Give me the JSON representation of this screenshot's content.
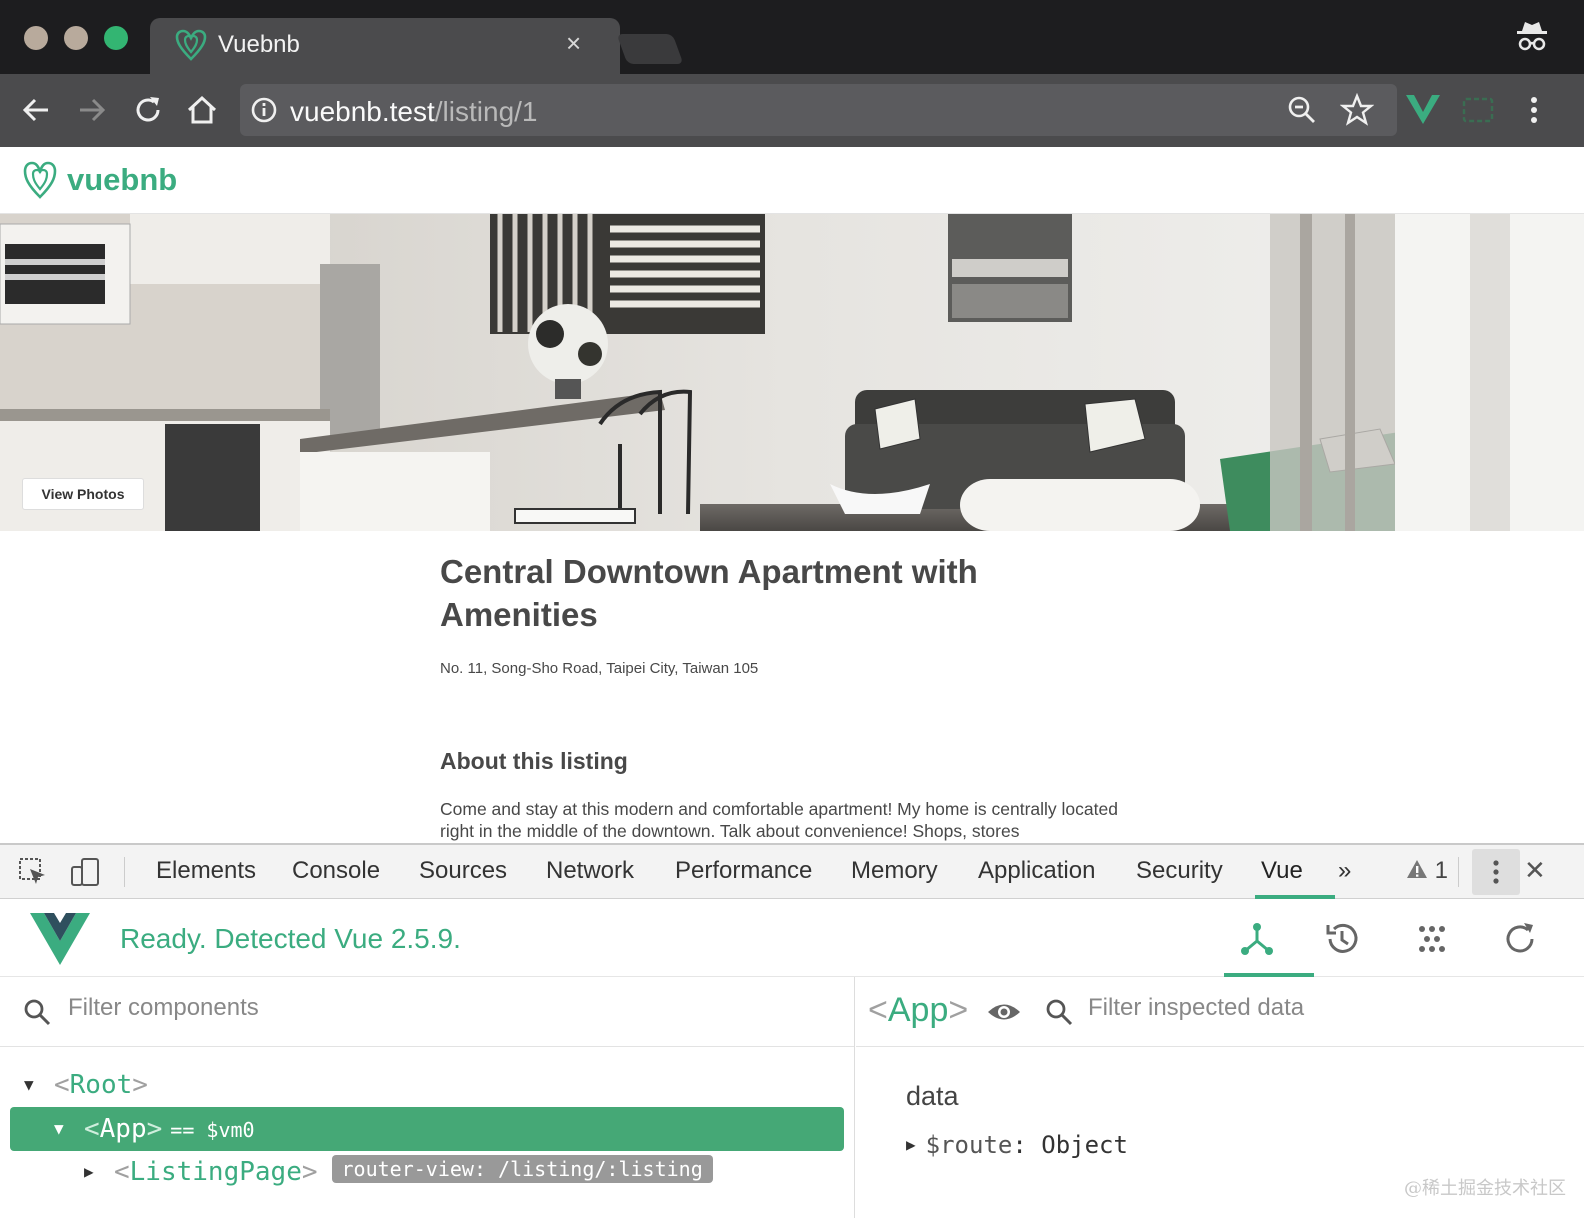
{
  "browser": {
    "tab_title": "Vuebnb",
    "tab_close": "×",
    "url_host": "vuebnb.test",
    "url_path": "/listing/1",
    "icons": [
      "back-icon",
      "forward-icon",
      "reload-icon",
      "home-icon",
      "info-icon",
      "zoom-icon",
      "star-icon",
      "vue-devtools-extension-icon",
      "extension-icon",
      "menu-icon",
      "incognito-icon"
    ],
    "traffic_colors": [
      "#b8aa9c",
      "#b8aa9c",
      "#33b572"
    ]
  },
  "site": {
    "name": "vuebnb",
    "accent": "#3bac80",
    "view_photos": "View Photos",
    "title": "Central Downtown Apartment with Amenities",
    "address": "No. 11, Song-Sho Road, Taipei City, Taiwan 105",
    "about_heading": "About this listing",
    "about_text": "Come and stay at this modern and comfortable apartment! My home is centrally located right in the middle of the downtown. Talk about convenience! Shops, stores"
  },
  "devtools": {
    "tabs": [
      "Elements",
      "Console",
      "Sources",
      "Network",
      "Performance",
      "Memory",
      "Application",
      "Security",
      "Vue"
    ],
    "active_tab": "Vue",
    "more": "»",
    "warning_count": "1",
    "close": "✕",
    "vue": {
      "status": "Ready. Detected Vue 2.5.9.",
      "filter_components_placeholder": "Filter components",
      "filter_data_placeholder": "Filter inspected data",
      "selected_component": "App",
      "tree": {
        "root": "Root",
        "app": "App",
        "app_vm": "== $vm0",
        "child": "ListingPage",
        "child_tag": "router-view: /listing/:listing"
      },
      "data_section": "data",
      "data_key": "$route",
      "data_value": "Object"
    }
  },
  "watermark": "@稀土掘金技术社区"
}
